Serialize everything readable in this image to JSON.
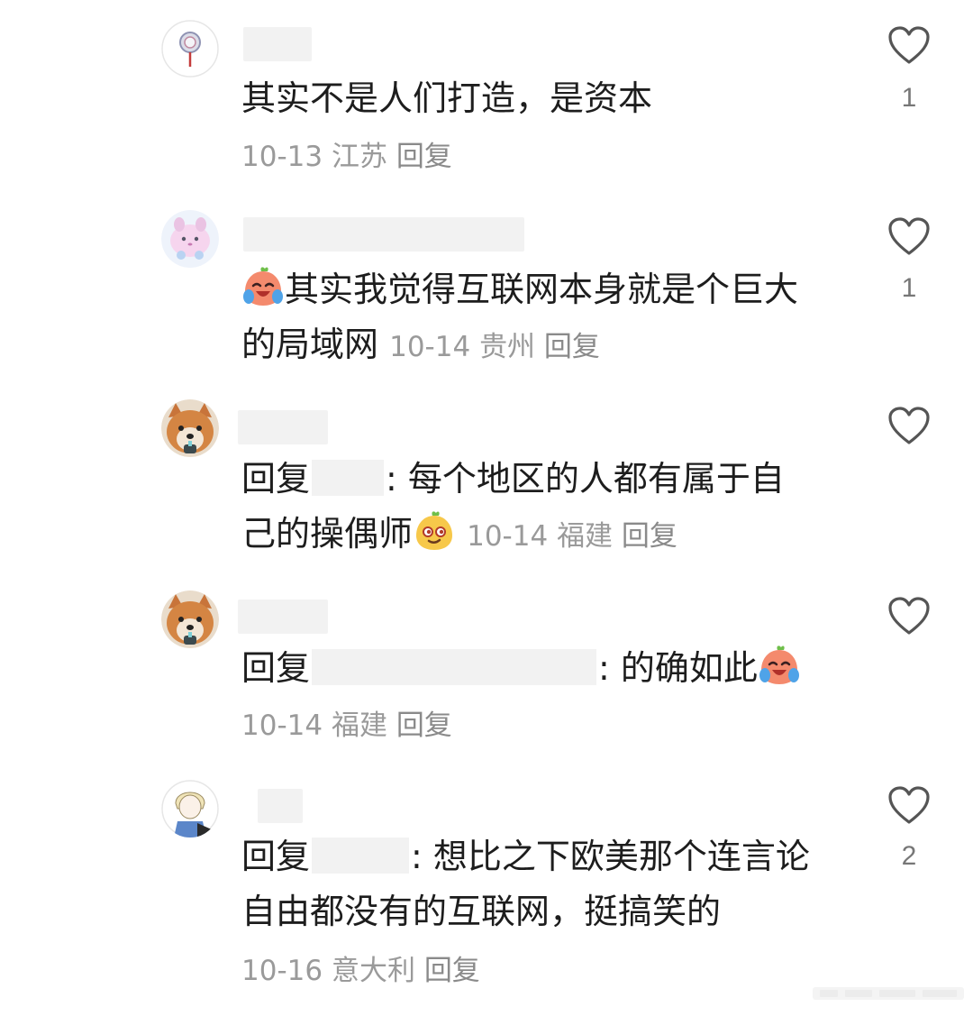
{
  "comments": [
    {
      "text": "其实不是人们打造，是资本",
      "date": "10-13",
      "location": "江苏",
      "reply_label": "回复",
      "likes": "1"
    },
    {
      "text_line1": "其实我觉得互联网本身就是个巨大",
      "text_line2": "的局域网",
      "date": "10-14",
      "location": "贵州",
      "reply_label": "回复",
      "likes": "1"
    },
    {
      "reply_prefix": "回复",
      "text_line1": ": 每个地区的人都有属于自",
      "text_line2": "己的操偶师",
      "date": "10-14",
      "location": "福建",
      "reply_label": "回复",
      "likes": ""
    },
    {
      "reply_prefix": "回复",
      "text": ": 的确如此",
      "date": "10-14",
      "location": "福建",
      "reply_label": "回复",
      "likes": ""
    },
    {
      "reply_prefix": "回复",
      "text_line1": ": 想比之下欧美那个连言论",
      "text_line2": "自由都没有的互联网，挺搞笑的",
      "date": "10-16",
      "location": "意大利",
      "reply_label": "回复",
      "likes": "2"
    }
  ],
  "icons": {
    "like": "heart-outline-icon",
    "laugh_cry": "laughing-crying-emoji-icon",
    "smirk": "smirk-emoji-icon"
  },
  "colors": {
    "text": "#1d1d1d",
    "meta": "#9a9a9a",
    "like_count": "#777777",
    "redaction": "#f2f2f2"
  }
}
